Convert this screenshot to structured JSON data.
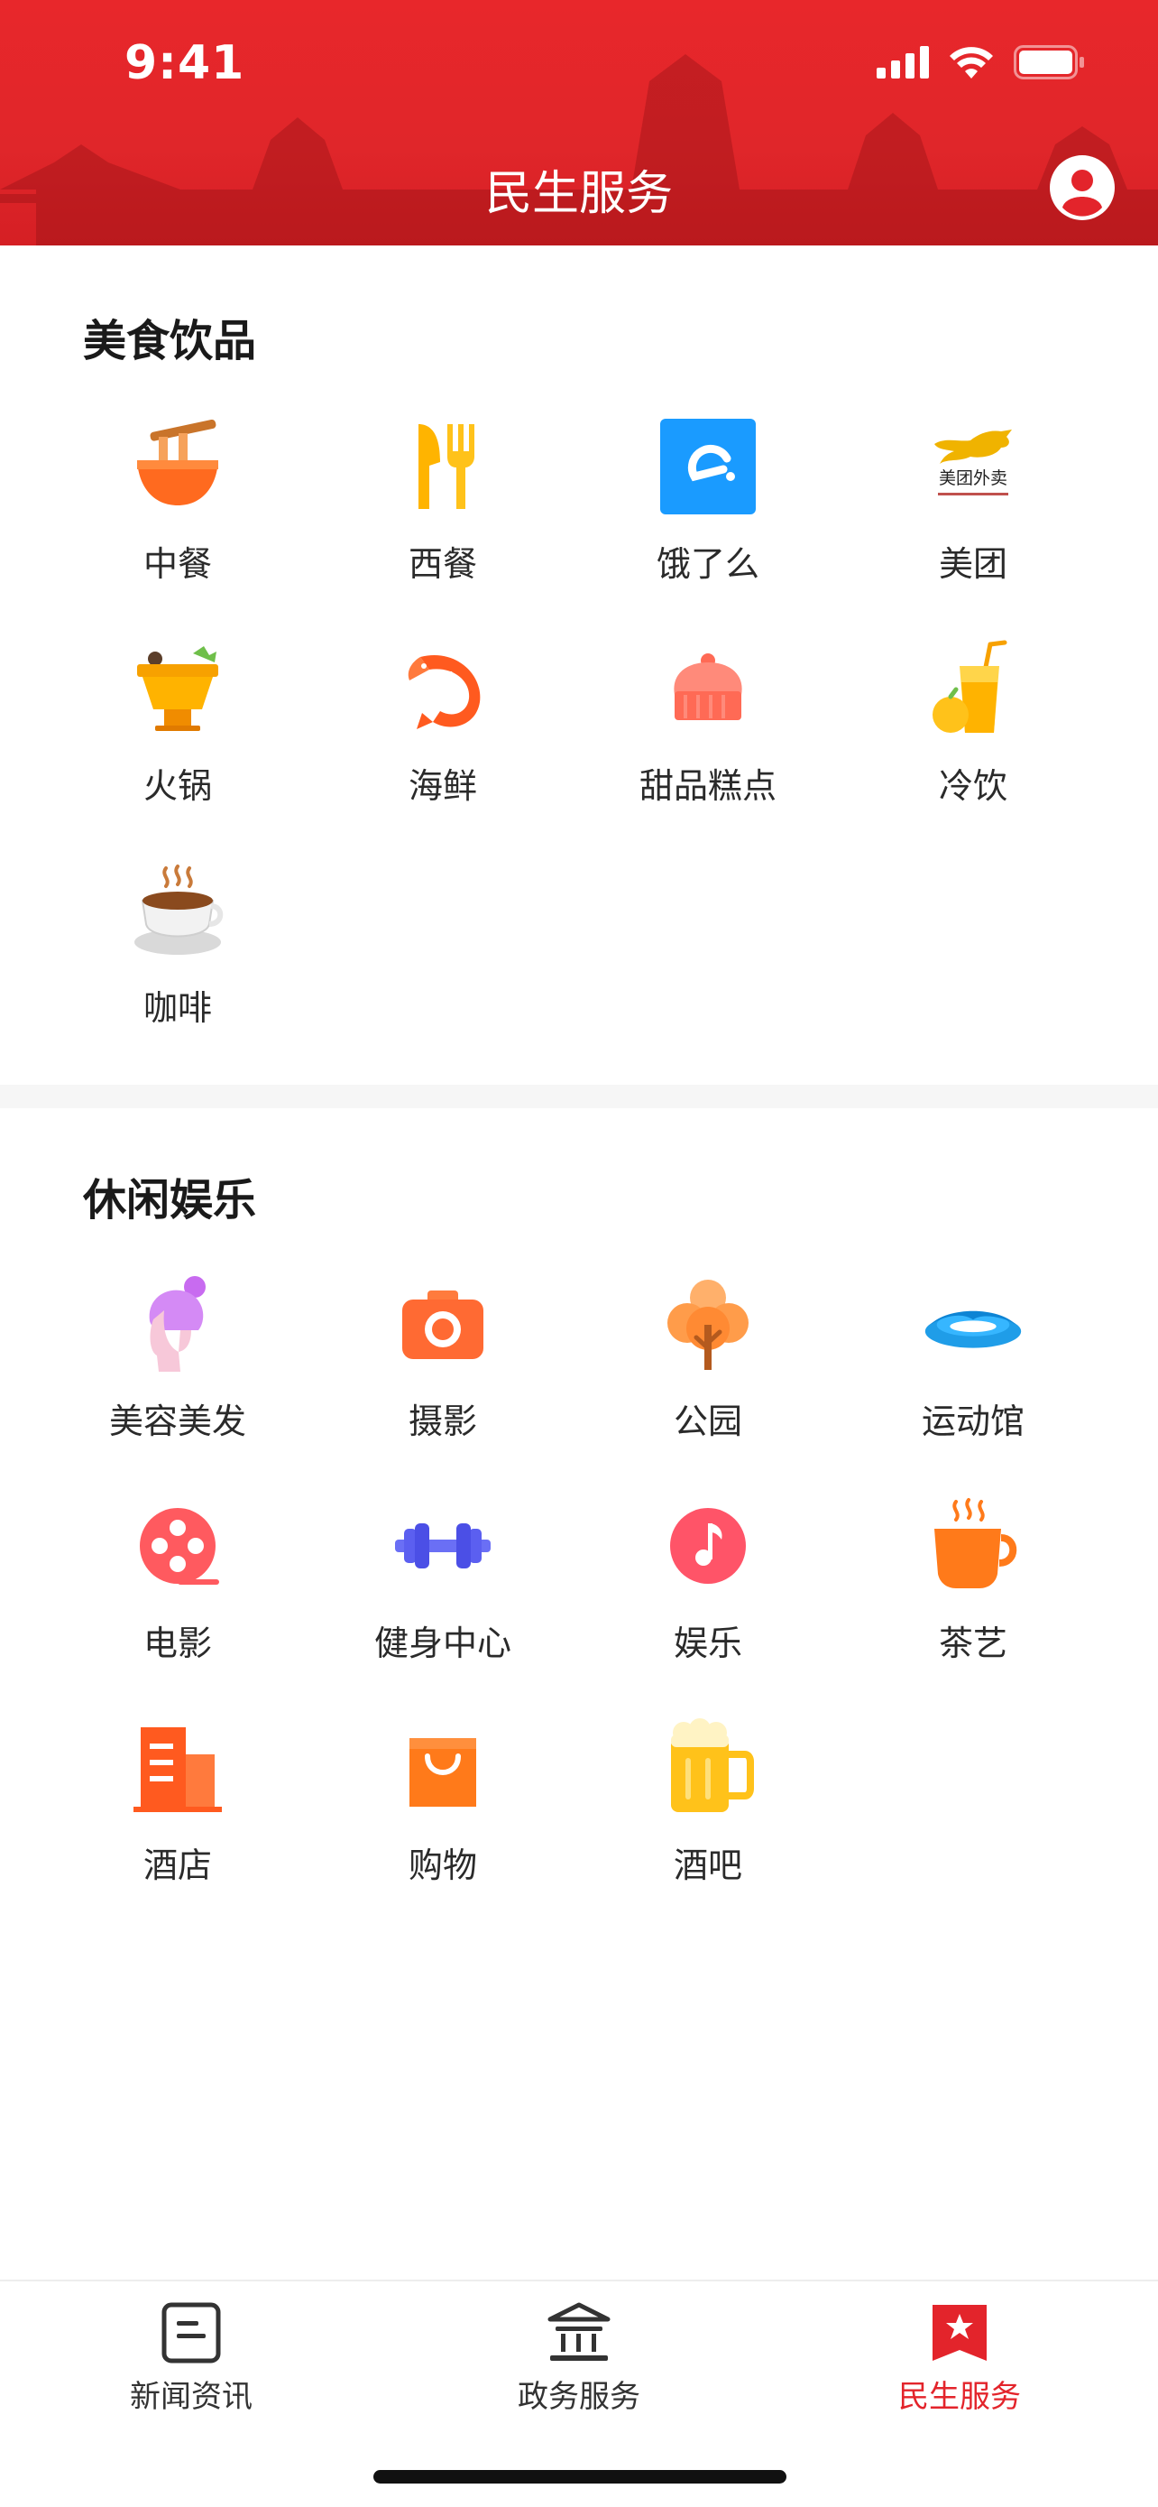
{
  "status_bar": {
    "time": "9:41"
  },
  "header": {
    "title": "民生服务"
  },
  "sections": [
    {
      "title": "美食饮品",
      "items": [
        {
          "label": "中餐",
          "icon": "noodle-bowl-icon"
        },
        {
          "label": "西餐",
          "icon": "fork-knife-icon"
        },
        {
          "label": "饿了么",
          "icon": "eleme-logo-icon"
        },
        {
          "label": "美团",
          "icon": "meituan-waimai-logo-icon",
          "logo_text": "美团外卖"
        },
        {
          "label": "火锅",
          "icon": "hotpot-icon"
        },
        {
          "label": "海鲜",
          "icon": "shrimp-icon"
        },
        {
          "label": "甜品糕点",
          "icon": "cake-icon"
        },
        {
          "label": "冷饮",
          "icon": "cold-drink-icon"
        },
        {
          "label": "咖啡",
          "icon": "coffee-cup-icon"
        }
      ]
    },
    {
      "title": "休闲娱乐",
      "items": [
        {
          "label": "美容美发",
          "icon": "hair-salon-icon"
        },
        {
          "label": "摄影",
          "icon": "camera-icon"
        },
        {
          "label": "公园",
          "icon": "tree-icon"
        },
        {
          "label": "运动馆",
          "icon": "stadium-icon"
        },
        {
          "label": "电影",
          "icon": "film-reel-icon"
        },
        {
          "label": "健身中心",
          "icon": "dumbbell-icon"
        },
        {
          "label": "娱乐",
          "icon": "music-note-icon"
        },
        {
          "label": "茶艺",
          "icon": "tea-cup-icon"
        },
        {
          "label": "酒店",
          "icon": "hotel-building-icon"
        },
        {
          "label": "购物",
          "icon": "shopping-bag-icon"
        },
        {
          "label": "酒吧",
          "icon": "beer-mug-icon"
        }
      ]
    }
  ],
  "tabbar": {
    "tabs": [
      {
        "label": "新闻资讯",
        "icon": "news-icon",
        "active": false
      },
      {
        "label": "政务服务",
        "icon": "government-building-icon",
        "active": false
      },
      {
        "label": "民生服务",
        "icon": "bookmark-star-icon",
        "active": true
      }
    ]
  },
  "colors": {
    "brand_red": "#e3242b",
    "header_red": "#e0262a",
    "text": "#2a2a2a"
  }
}
